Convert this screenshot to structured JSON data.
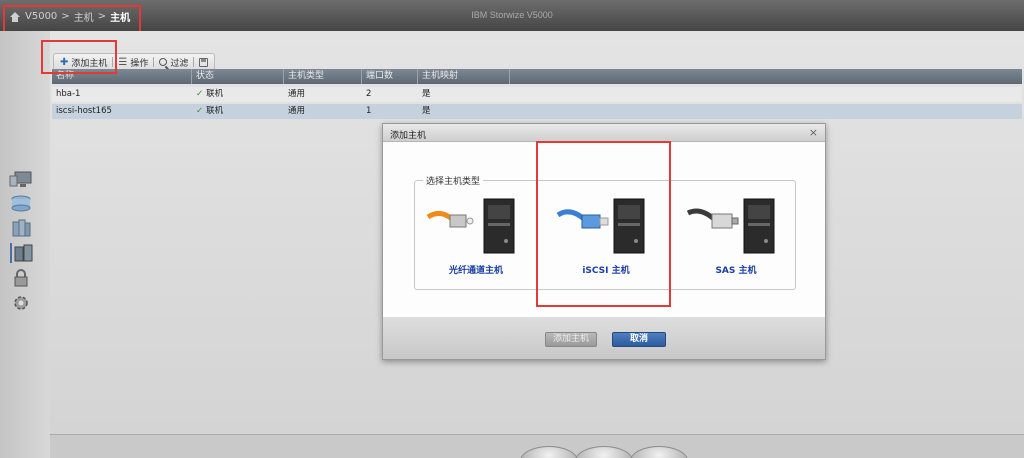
{
  "header": {
    "breadcrumb": [
      "V5000",
      "主机",
      "主机"
    ],
    "app_title": "IBM Storwize V5000"
  },
  "toolbar": {
    "add_host": "添加主机",
    "actions": "操作",
    "filter": "过滤"
  },
  "table": {
    "columns": [
      "名称",
      "状态",
      "主机类型",
      "端口数",
      "主机映射"
    ],
    "rows": [
      {
        "name": "hba-1",
        "status": "联机",
        "type": "通用",
        "ports": "2",
        "mapping": "是"
      },
      {
        "name": "iscsi-host165",
        "status": "联机",
        "type": "通用",
        "ports": "1",
        "mapping": "是"
      }
    ]
  },
  "dialog": {
    "title": "添加主机",
    "group_label": "选择主机类型",
    "options": [
      "光纤通道主机",
      "iSCSI 主机",
      "SAS 主机"
    ],
    "add_button": "添加主机",
    "cancel_button": "取消"
  },
  "colors": {
    "highlight": "#e53935",
    "primary_button": "#2d5c9e",
    "option_label": "#1a3fa3"
  }
}
